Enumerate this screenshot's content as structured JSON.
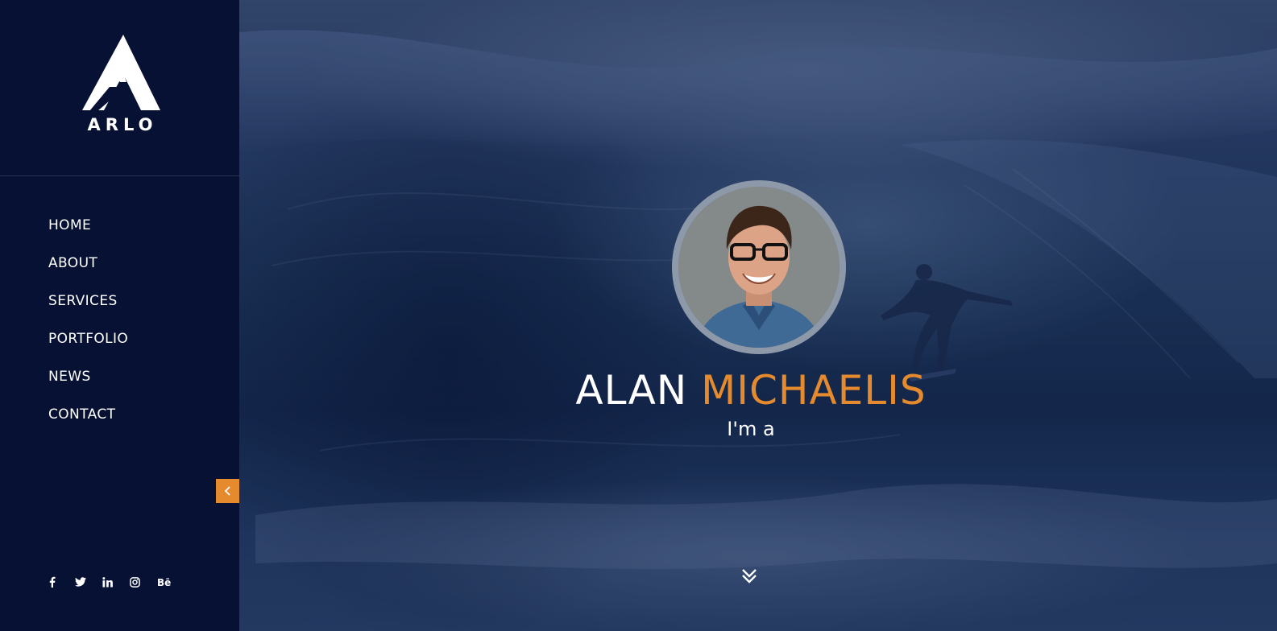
{
  "brand": {
    "name": "ARLO",
    "logo_icon": "arlo-mountain-logo"
  },
  "nav": {
    "items": [
      {
        "label": "HOME"
      },
      {
        "label": "ABOUT"
      },
      {
        "label": "SERVICES"
      },
      {
        "label": "PORTFOLIO"
      },
      {
        "label": "NEWS"
      },
      {
        "label": "CONTACT"
      }
    ],
    "collapse_icon": "chevron-left-icon"
  },
  "socials": [
    {
      "icon": "facebook-icon",
      "glyph": "f"
    },
    {
      "icon": "twitter-icon",
      "glyph": ""
    },
    {
      "icon": "linkedin-icon",
      "glyph": "in"
    },
    {
      "icon": "instagram-icon",
      "glyph": ""
    },
    {
      "icon": "behance-icon",
      "glyph": "Bē"
    }
  ],
  "hero": {
    "first_name": "ALAN",
    "last_name": "MICHAELIS",
    "subtitle": "I'm a",
    "scroll_icon": "double-chevron-down-icon"
  },
  "colors": {
    "sidebar_bg": "#061133",
    "accent": "#e68a2e",
    "text": "#ffffff"
  }
}
